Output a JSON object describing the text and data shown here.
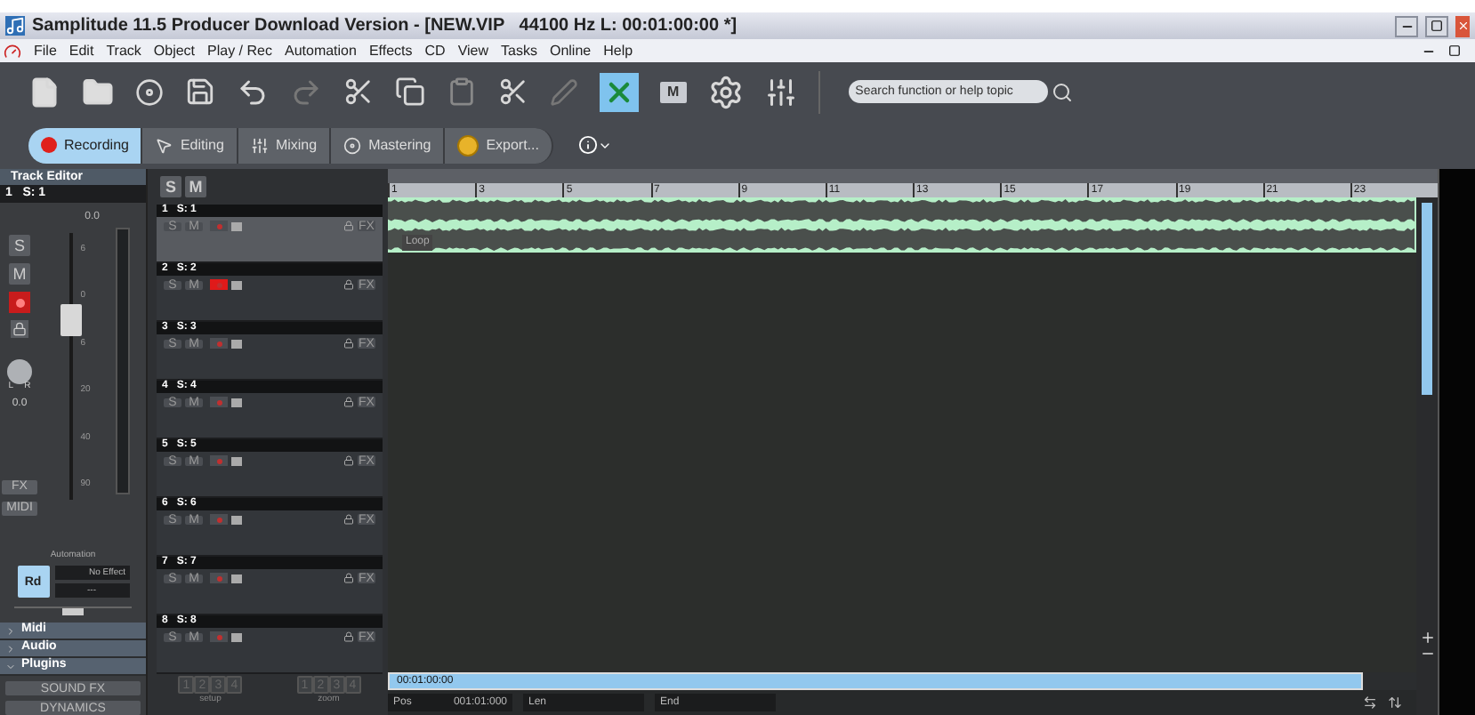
{
  "window": {
    "title": "Samplitude 11.5 Producer Download Version - [NEW.VIP   44100 Hz L: 00:01:00:00 *]"
  },
  "menu": [
    "File",
    "Edit",
    "Track",
    "Object",
    "Play / Rec",
    "Automation",
    "Effects",
    "CD",
    "View",
    "Tasks",
    "Online",
    "Help"
  ],
  "toolbar": {
    "search": {
      "placeholder": "Search function or help topic"
    },
    "m_button": "M",
    "crossfade_active": true
  },
  "modes": [
    {
      "label": "Recording",
      "selected": true
    },
    {
      "label": "Editing",
      "selected": false
    },
    {
      "label": "Mixing",
      "selected": false
    },
    {
      "label": "Mastering",
      "selected": false
    },
    {
      "label": "Export...",
      "selected": false
    }
  ],
  "track_editor": {
    "title": "Track Editor",
    "track": "1   S: 1",
    "volume": "0.0",
    "solo": "S",
    "mute": "M",
    "record_armed": true,
    "scale": [
      "6",
      "0",
      "6",
      "20",
      "40",
      "90"
    ],
    "fader": {
      "level": 0.7
    },
    "pan_left": "L",
    "pan_right": "R",
    "pan": "0.0",
    "fx": "FX",
    "midi": "MIDI",
    "automation": "Automation",
    "automation_slider": {
      "level": 0.5
    },
    "read": "Rd",
    "effect": "No Effect",
    "effect_value": "---"
  },
  "sections": [
    {
      "label": "Midi",
      "expanded": false
    },
    {
      "label": "Audio",
      "expanded": false
    },
    {
      "label": "Plugins",
      "expanded": true
    }
  ],
  "plugins": [
    "SOUND FX",
    "DYNAMICS"
  ],
  "track_header": {
    "solo": "S",
    "mute": "M"
  },
  "tracks": [
    {
      "number": "1",
      "name": "S: 1",
      "selected": true,
      "armed": false,
      "solo": "S",
      "mute": "M",
      "fx": "FX"
    },
    {
      "number": "2",
      "name": "S: 2",
      "selected": false,
      "armed": true,
      "solo": "S",
      "mute": "M",
      "fx": "FX"
    },
    {
      "number": "3",
      "name": "S: 3",
      "selected": false,
      "armed": false,
      "solo": "S",
      "mute": "M",
      "fx": "FX"
    },
    {
      "number": "4",
      "name": "S: 4",
      "selected": false,
      "armed": false,
      "solo": "S",
      "mute": "M",
      "fx": "FX"
    },
    {
      "number": "5",
      "name": "S: 5",
      "selected": false,
      "armed": false,
      "solo": "S",
      "mute": "M",
      "fx": "FX"
    },
    {
      "number": "6",
      "name": "S: 6",
      "selected": false,
      "armed": false,
      "solo": "S",
      "mute": "M",
      "fx": "FX"
    },
    {
      "number": "7",
      "name": "S: 7",
      "selected": false,
      "armed": false,
      "solo": "S",
      "mute": "M",
      "fx": "FX"
    },
    {
      "number": "8",
      "name": "S: 8",
      "selected": false,
      "armed": false,
      "solo": "S",
      "mute": "M",
      "fx": "FX"
    }
  ],
  "setup": {
    "label": "setup",
    "buttons": [
      "1",
      "2",
      "3",
      "4"
    ]
  },
  "zoom": {
    "label": "zoom",
    "buttons": [
      "1",
      "2",
      "3",
      "4"
    ]
  },
  "ruler": [
    "1",
    "3",
    "5",
    "7",
    "9",
    "11",
    "13",
    "15",
    "17",
    "19",
    "21",
    "23"
  ],
  "clip": {
    "label": "Loop"
  },
  "transport": {
    "time": "00:01:00:00",
    "pos_label": "Pos",
    "pos": "001:01:000",
    "len_label": "Len",
    "end_label": "End"
  }
}
